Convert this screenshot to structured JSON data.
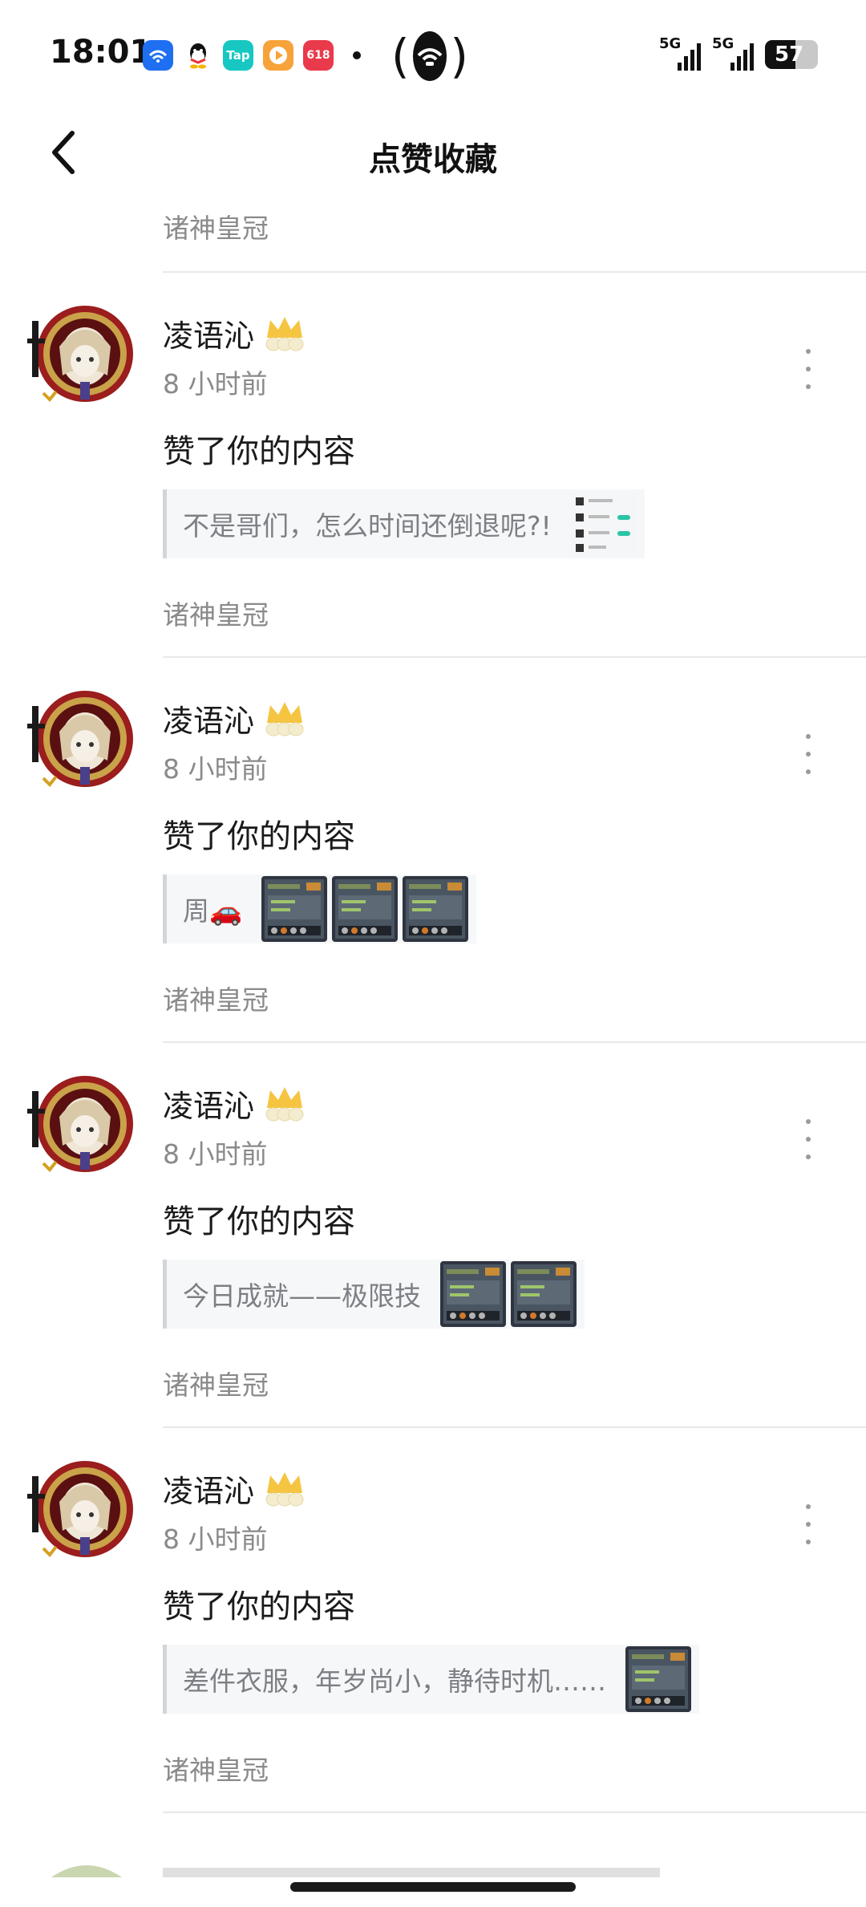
{
  "status_bar": {
    "time": "18:01",
    "apps": [
      {
        "icon": "cloud-app-icon",
        "color": "#1e6ff2",
        "label": ""
      },
      {
        "icon": "qq-icon",
        "color": "#ffffff",
        "label": ""
      },
      {
        "icon": "taptap-icon",
        "color": "#16c7c2",
        "label": "Tap"
      },
      {
        "icon": "video-app-icon",
        "color": "#f7a33b",
        "label": ""
      },
      {
        "icon": "shopping-app-icon",
        "color": "#e93a4b",
        "label": "618"
      }
    ],
    "signal_1_label": "5G",
    "signal_2_label": "5G",
    "battery": "57",
    "battery_level": 0.57
  },
  "header": {
    "title": "点赞收藏"
  },
  "top_group": "诸神皇冠",
  "items": [
    {
      "username": "凌语沁",
      "time": "8 小时前",
      "action": "赞了你的内容",
      "quote": "不是哥们，怎么时间还倒退呢?!",
      "thumbs": [
        "light"
      ],
      "group": "诸神皇冠"
    },
    {
      "username": "凌语沁",
      "time": "8 小时前",
      "action": "赞了你的内容",
      "quote": "周🚗",
      "thumbs": [
        "dark",
        "dark",
        "dark"
      ],
      "group": "诸神皇冠"
    },
    {
      "username": "凌语沁",
      "time": "8 小时前",
      "action": "赞了你的内容",
      "quote": "今日成就——极限技",
      "thumbs": [
        "dark",
        "dark"
      ],
      "group": "诸神皇冠"
    },
    {
      "username": "凌语沁",
      "time": "8 小时前",
      "action": "赞了你的内容",
      "quote": "差件衣服，年岁尚小，静待时机……",
      "thumbs": [
        "dark"
      ],
      "group": "诸神皇冠"
    }
  ]
}
